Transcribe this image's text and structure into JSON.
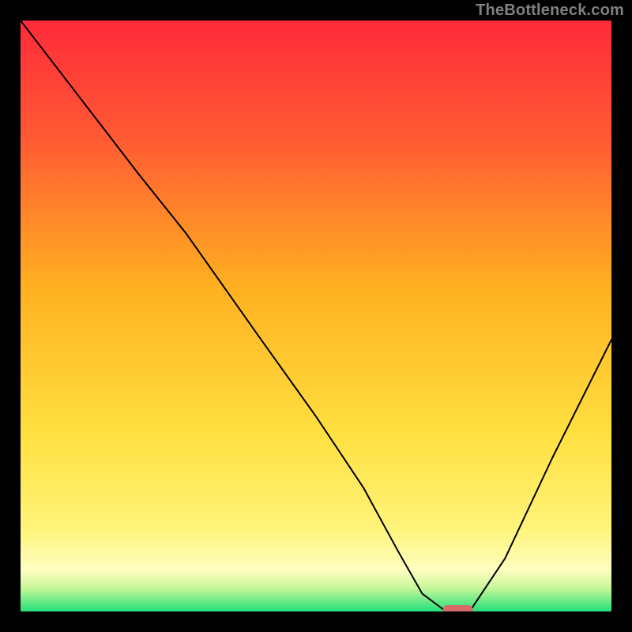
{
  "watermark": "TheBottleneck.com",
  "chart_data": {
    "type": "line",
    "title": "",
    "xlabel": "",
    "ylabel": "",
    "xlim": [
      0,
      100
    ],
    "ylim": [
      0,
      100
    ],
    "x": [
      0,
      10,
      20,
      28,
      40,
      50,
      58,
      64,
      68,
      72,
      76,
      82,
      90,
      100
    ],
    "values": [
      100,
      87,
      74,
      64,
      47,
      33,
      21,
      10,
      3,
      0,
      0,
      9,
      26,
      46
    ],
    "annotations": [
      {
        "kind": "optimum_marker",
        "x_start": 72,
        "x_end": 76,
        "y": 0
      }
    ],
    "background_gradient": {
      "direction": "vertical",
      "stops": [
        {
          "pos": 0.0,
          "color": "#ff2a3a"
        },
        {
          "pos": 0.2,
          "color": "#ff5a33"
        },
        {
          "pos": 0.45,
          "color": "#ffb020"
        },
        {
          "pos": 0.7,
          "color": "#ffe040"
        },
        {
          "pos": 0.86,
          "color": "#fff47a"
        },
        {
          "pos": 0.93,
          "color": "#fffec0"
        },
        {
          "pos": 0.96,
          "color": "#c8f79a"
        },
        {
          "pos": 1.0,
          "color": "#22e07a"
        }
      ]
    },
    "marker_color": "#d86a6a"
  }
}
